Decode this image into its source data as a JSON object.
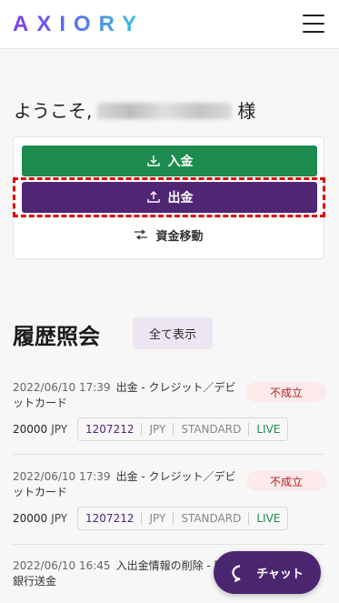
{
  "header": {
    "logo": "AXIORY"
  },
  "welcome": {
    "prefix": "ようこそ,",
    "suffix": "様"
  },
  "actions": {
    "deposit": "入金",
    "withdraw": "出金",
    "transfer": "資金移動"
  },
  "history": {
    "title": "履歴照会",
    "show_all": "全て表示"
  },
  "transactions": [
    {
      "date": "2022/06/10 17:39",
      "desc": "出金 - クレジット／デビットカード",
      "status": "不成立",
      "amount": "20000",
      "currency": "JPY",
      "account": "1207212",
      "acct_currency": "JPY",
      "acct_type": "STANDARD",
      "acct_mode": "LIVE"
    },
    {
      "date": "2022/06/10 17:39",
      "desc": "出金 - クレジット／デビットカード",
      "status": "不成立",
      "amount": "20000",
      "currency": "JPY",
      "account": "1207212",
      "acct_currency": "JPY",
      "acct_type": "STANDARD",
      "acct_mode": "LIVE"
    },
    {
      "date": "2022/06/10 16:45",
      "desc": "入出金情報の削除 - 国内銀行送金"
    }
  ],
  "chat": {
    "label": "チャット"
  },
  "colors": {
    "primary": "#4f2673",
    "deposit": "#1d8a4e",
    "status_fail": "#b32020",
    "highlight": "#e00000"
  }
}
